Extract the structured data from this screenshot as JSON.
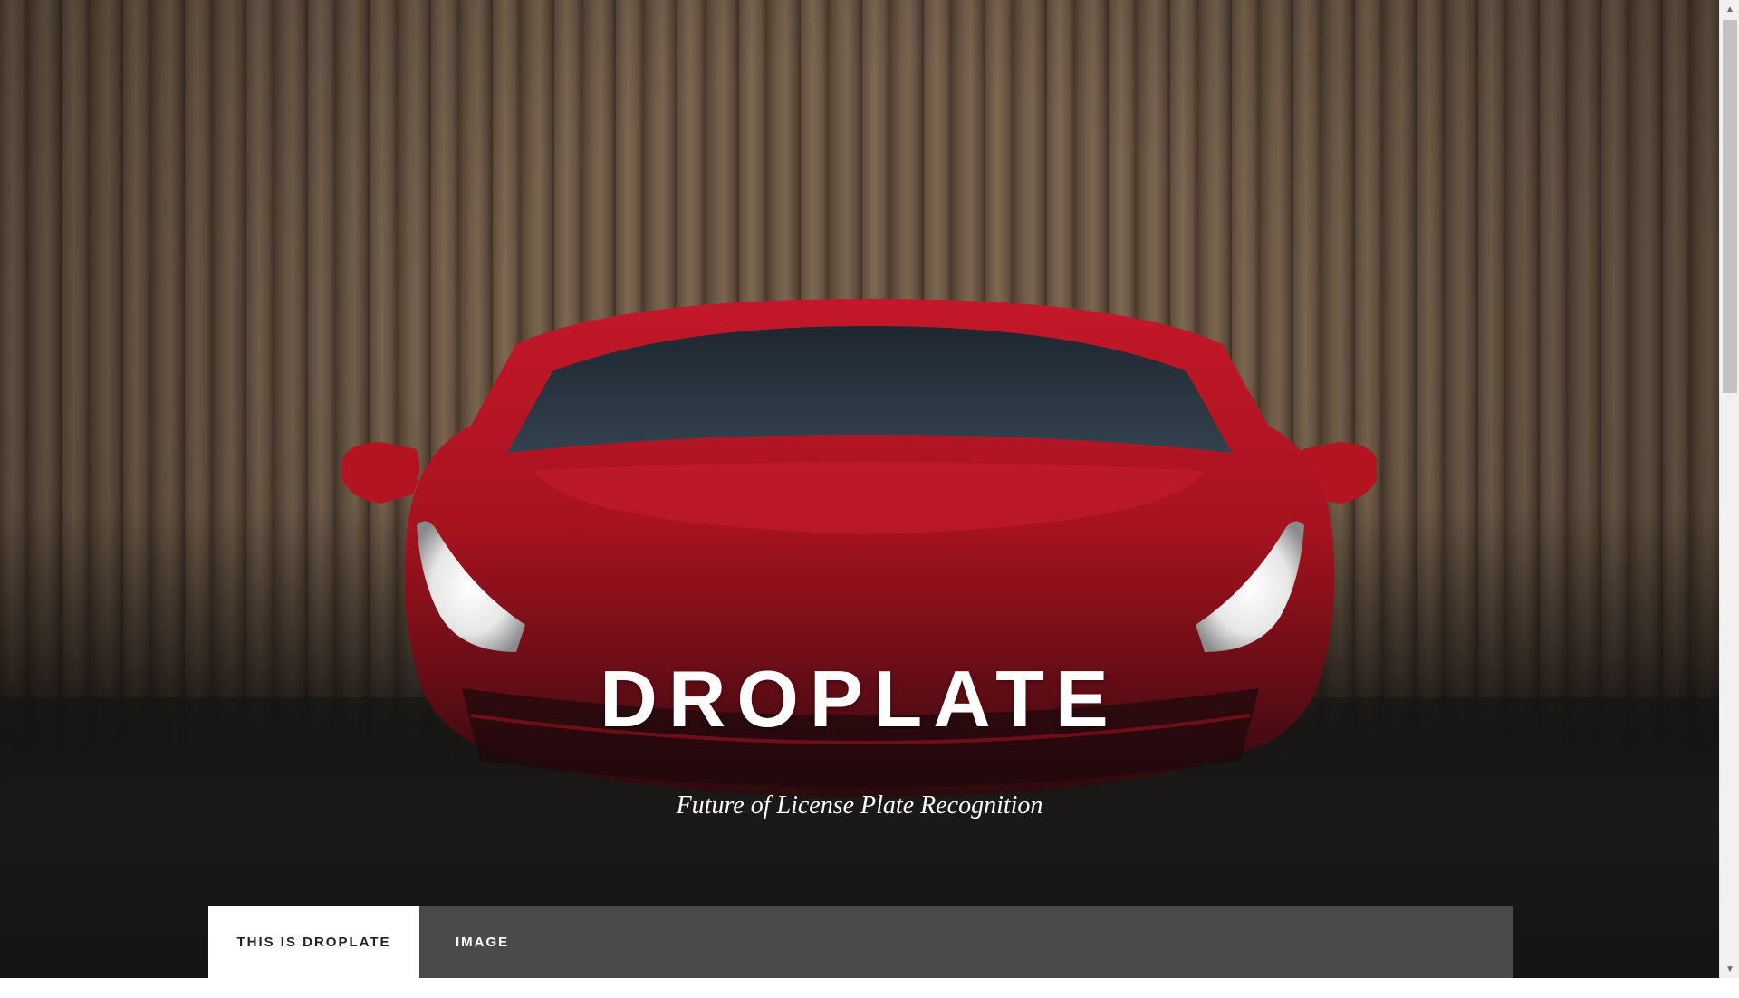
{
  "hero": {
    "title": "DROPLATE",
    "subtitle": "Future of License Plate Recognition"
  },
  "nav": {
    "items": [
      {
        "label": "THIS IS DROPLATE",
        "active": true
      },
      {
        "label": "IMAGE",
        "active": false
      }
    ]
  },
  "scrollbar": {
    "up_icon": "triangle-up",
    "down_icon": "triangle-down"
  },
  "colors": {
    "nav_background": "#4a4a4a",
    "active_tab": "#ffffff",
    "car_red": "#b01322"
  }
}
